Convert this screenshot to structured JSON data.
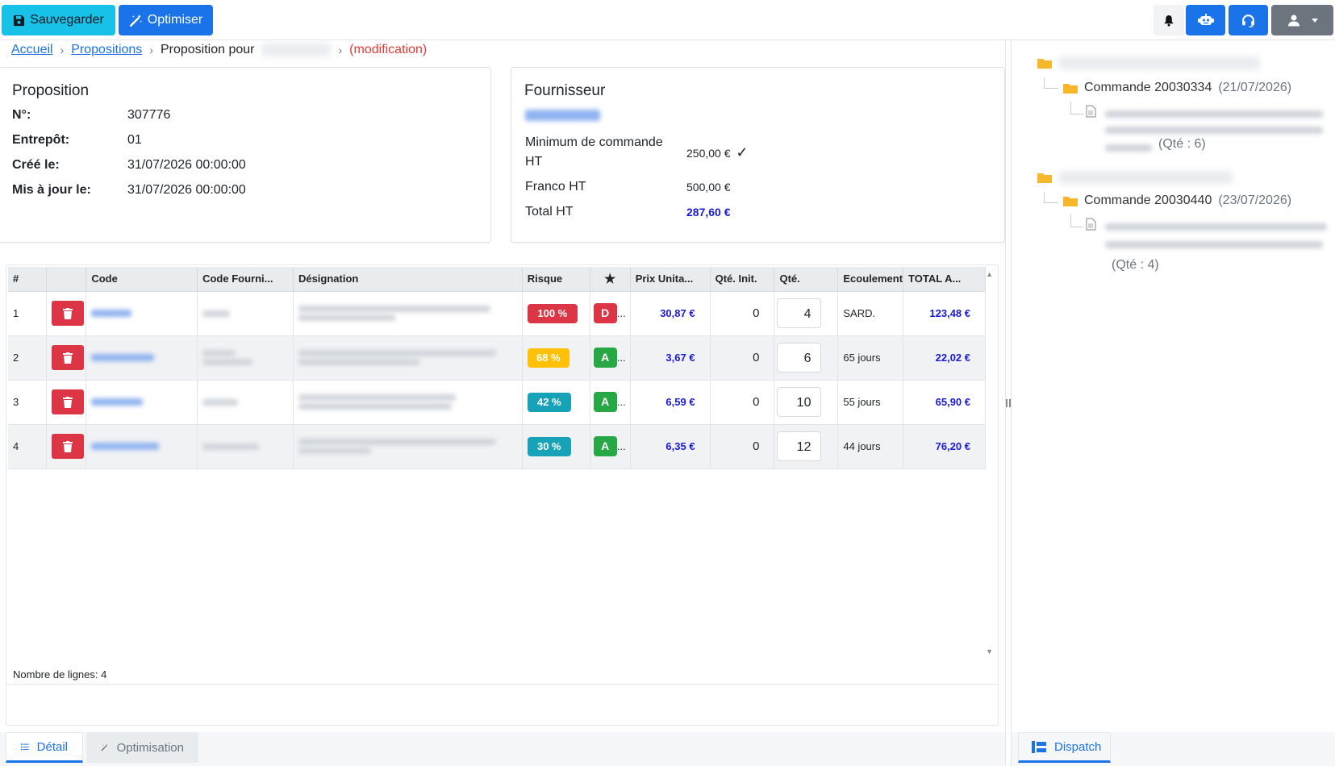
{
  "toolbar": {
    "save_label": "Sauvegarder",
    "optimize_label": "Optimiser"
  },
  "breadcrumb": {
    "home": "Accueil",
    "proposals": "Propositions",
    "current": "Proposition pour",
    "current_name_blurred": "BEYTANCE",
    "mode": "(modification)"
  },
  "proposition": {
    "title": "Proposition",
    "fields": [
      {
        "label": "N°:",
        "value": "307776"
      },
      {
        "label": "Entrepôt:",
        "value": "01"
      },
      {
        "label": "Créé le:",
        "value": "31/07/2026 00:00:00"
      },
      {
        "label": "Mis à jour le:",
        "value": "31/07/2026 00:00:00"
      }
    ]
  },
  "fournisseur": {
    "title": "Fournisseur",
    "name_blurred": "SM FOURNI",
    "min_label": "Minimum de commande HT",
    "min_value": "250,00 €",
    "min_ok": "✓",
    "franco_label": "Franco HT",
    "franco_value": "500,00 €",
    "total_label": "Total HT",
    "total_value": "287,60 €"
  },
  "table": {
    "headers": [
      "#",
      "",
      "Code",
      "Code Fourni...",
      "Désignation",
      "Risque",
      "★",
      "Prix Unita...",
      "Qté. Init.",
      "Qté.",
      "Ecoulement",
      "TOTAL A..."
    ],
    "rows": [
      {
        "num": "1",
        "risk": "100 %",
        "risk_color": "#dc3545",
        "grade": "D",
        "grade_color": "#dc3545",
        "ellipsis": "...",
        "price": "30,87 €",
        "qte_init": "0",
        "qte": "4",
        "ecoulement": "SARD.",
        "total": "123,48 €"
      },
      {
        "num": "2",
        "risk": "68 %",
        "risk_color": "#ffc107",
        "grade": "A",
        "grade_color": "#28a745",
        "ellipsis": "...",
        "price": "3,67 €",
        "qte_init": "0",
        "qte": "6",
        "ecoulement": "65 jours",
        "total": "22,02 €"
      },
      {
        "num": "3",
        "risk": "42 %",
        "risk_color": "#17a2b8",
        "grade": "A",
        "grade_color": "#28a745",
        "ellipsis": "...",
        "price": "6,59 €",
        "qte_init": "0",
        "qte": "10",
        "ecoulement": "55 jours",
        "total": "65,90 €"
      },
      {
        "num": "4",
        "risk": "30 %",
        "risk_color": "#17a2b8",
        "grade": "A",
        "grade_color": "#28a745",
        "ellipsis": "...",
        "price": "6,35 €",
        "qte_init": "0",
        "qte": "12",
        "ecoulement": "44 jours",
        "total": "76,20 €"
      }
    ],
    "row_count": "Nombre de lignes: 4"
  },
  "tabs": {
    "detail": "Détail",
    "optimisation": "Optimisation"
  },
  "tree": {
    "commande1": "Commande 20030334",
    "commande1_date": "(21/07/2026)",
    "commande1_qte": "(Qté : 6)",
    "commande2": "Commande 20030440",
    "commande2_date": "(23/07/2026)",
    "commande2_qte": "(Qté : 4)"
  },
  "right_tabs": {
    "dispatch": "Dispatch"
  },
  "colors": {
    "primary": "#1a73e8",
    "info": "#17c1e8",
    "danger": "#dc3545",
    "success": "#28a745",
    "warning": "#ffc107",
    "price": "#1a1ad6"
  },
  "icons": [
    "save-icon",
    "magic-wand-icon",
    "bell-icon",
    "robot-icon",
    "headset-icon",
    "user-icon",
    "caret-down-icon",
    "trash-icon",
    "star-icon",
    "folder-icon",
    "file-icon",
    "list-icon",
    "dispatch-icon",
    "sort-up-icon",
    "sort-down-icon"
  ]
}
